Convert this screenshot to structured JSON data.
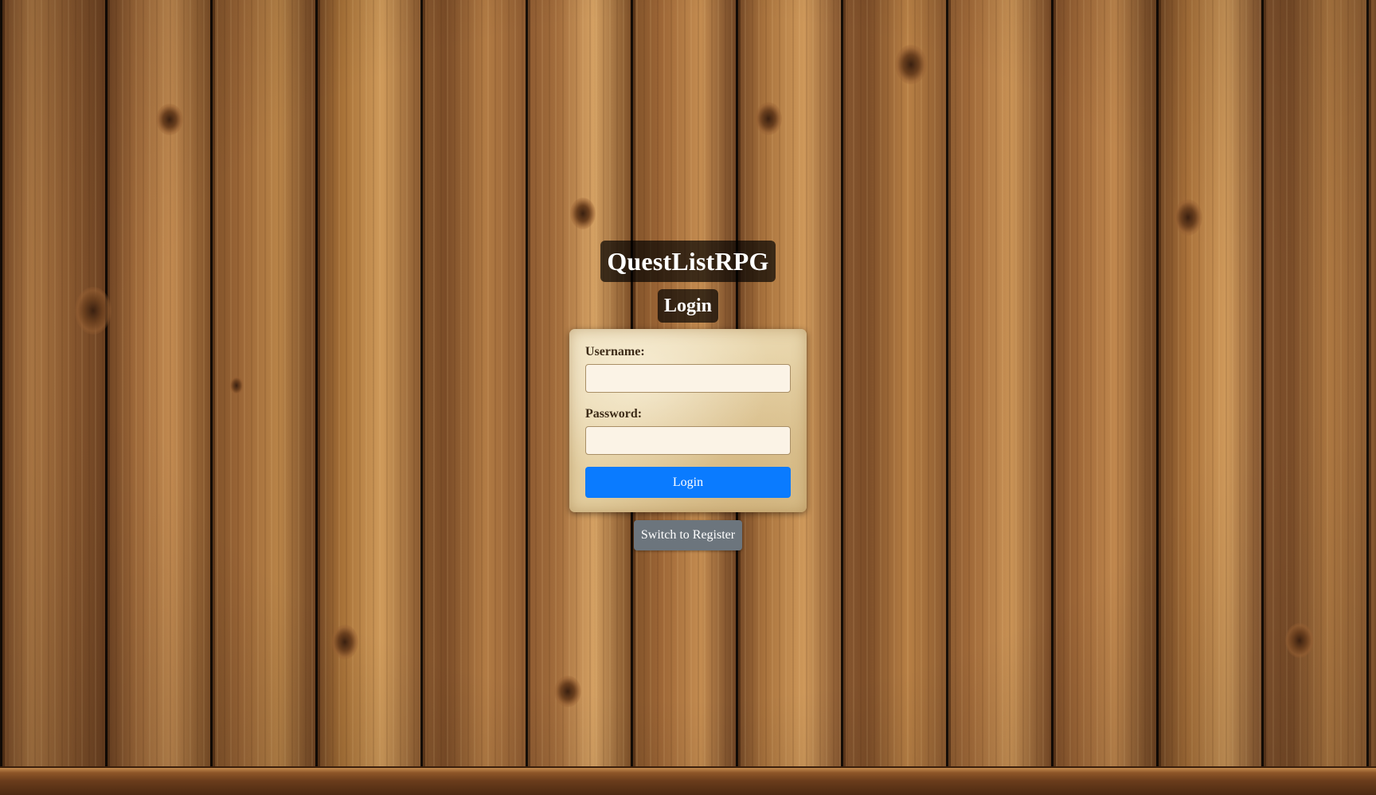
{
  "app": {
    "title": "QuestListRPG"
  },
  "login_form": {
    "heading": "Login",
    "username_label": "Username:",
    "username_value": "",
    "password_label": "Password:",
    "password_value": "",
    "submit_label": "Login"
  },
  "switch_button": {
    "label": "Switch to Register"
  },
  "colors": {
    "primary_button": "#0a7bff",
    "secondary_button": "#6c757d",
    "title_backdrop": "#000000",
    "card_parchment": "#e6d2a6"
  },
  "background": {
    "texture": "wood-plank-wall"
  }
}
